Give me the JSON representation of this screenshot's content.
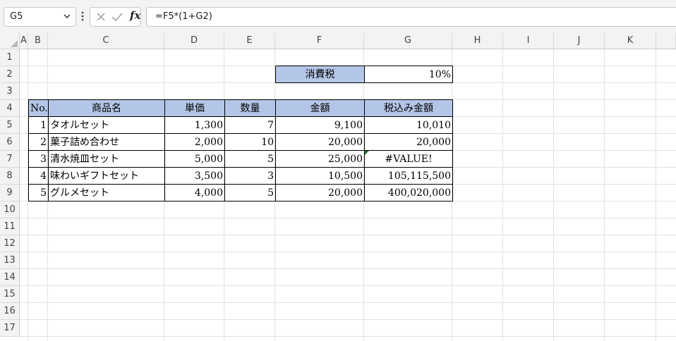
{
  "formula_bar": {
    "name_box": "G5",
    "fx_label": "fx",
    "formula": "=F5*(1+G2)"
  },
  "columns": [
    "A",
    "B",
    "C",
    "D",
    "E",
    "F",
    "G",
    "H",
    "I",
    "J",
    "K"
  ],
  "rows": [
    "1",
    "2",
    "3",
    "4",
    "5",
    "6",
    "7",
    "8",
    "9",
    "10",
    "11",
    "12",
    "13",
    "14",
    "15",
    "16",
    "17"
  ],
  "tax": {
    "label": "消費税",
    "value": "10%"
  },
  "table": {
    "headers": [
      "No.",
      "商品名",
      "単価",
      "数量",
      "金額",
      "税込み金額"
    ],
    "rows": [
      [
        "1",
        "タオルセット",
        "1,300",
        "7",
        "9,100",
        "10,010"
      ],
      [
        "2",
        "菓子詰め合わせ",
        "2,000",
        "10",
        "20,000",
        "20,000"
      ],
      [
        "3",
        "清水焼皿セット",
        "5,000",
        "5",
        "25,000",
        "#VALUE!"
      ],
      [
        "4",
        "味わいギフトセット",
        "3,500",
        "3",
        "10,500",
        "105,115,500"
      ],
      [
        "5",
        "グルメセット",
        "4,000",
        "5",
        "20,000",
        "400,020,000"
      ]
    ]
  },
  "colors": {
    "header_fill": "#b4c6e7",
    "error_flag": "#1e7a32"
  }
}
